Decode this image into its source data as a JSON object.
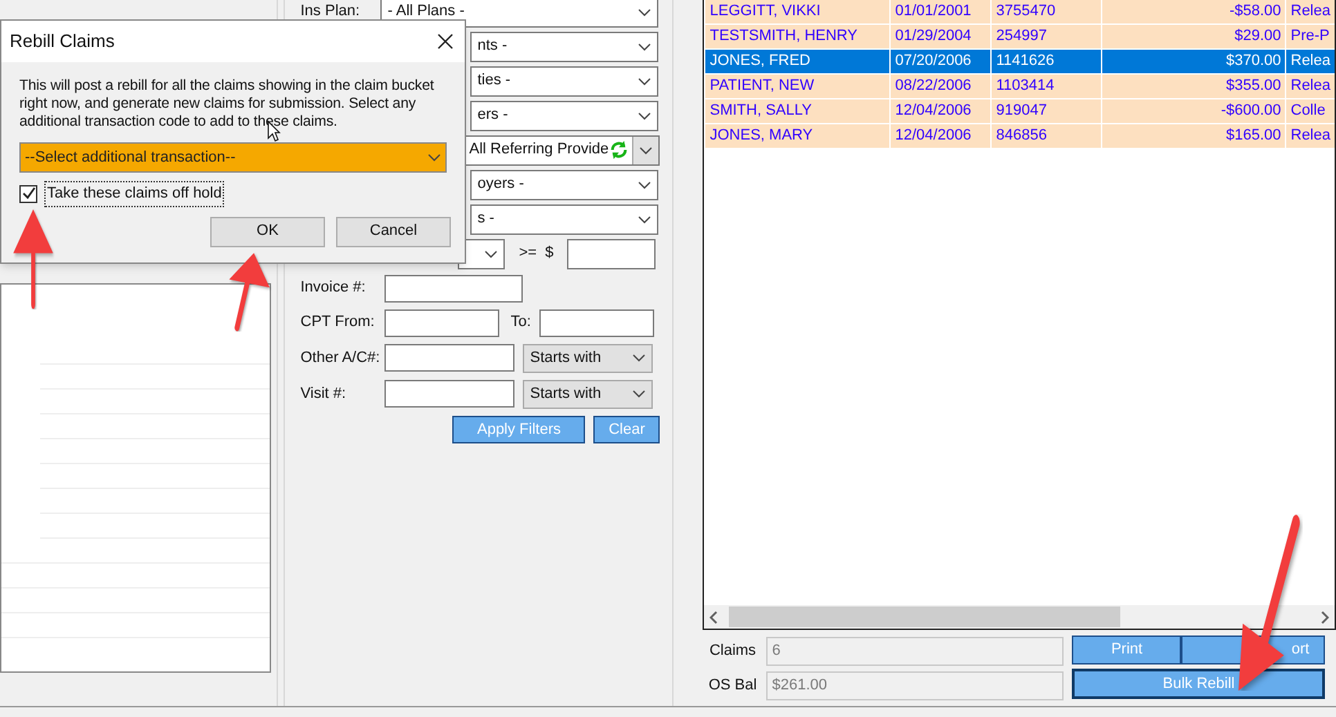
{
  "dialog": {
    "title": "Rebill Claims",
    "message": "This will post a rebill for all the claims showing in the claim bucket right now, and generate new claims for submission. Select any additional transaction code to add to these claims.",
    "transaction_select": {
      "value": "--Select additional transaction--"
    },
    "off_hold_checkbox": {
      "label": "Take these claims off hold",
      "checked": true
    },
    "buttons": [
      "OK",
      "Cancel"
    ]
  },
  "filters": [
    {
      "kind": "select",
      "label": "Ins Plan:",
      "value": "- All Plans -"
    },
    {
      "kind": "select",
      "value": "nts -"
    },
    {
      "kind": "select",
      "value": "ties -"
    },
    {
      "kind": "select",
      "value": "ers -"
    },
    {
      "kind": "refresh_select",
      "value": "All Referring Provide"
    },
    {
      "kind": "select",
      "value": "oyers -"
    },
    {
      "kind": "select",
      "value": "s -"
    },
    {
      "kind": "amount",
      "operator": ">=",
      "currency": "$"
    },
    {
      "kind": "text",
      "label": "Invoice #:"
    },
    {
      "kind": "range",
      "label": "CPT From:",
      "to_label": "To:"
    },
    {
      "kind": "match",
      "label": "Other A/C#:",
      "match": "Starts with"
    },
    {
      "kind": "match",
      "label": "Visit #:",
      "match": "Starts with"
    }
  ],
  "filter_buttons": [
    "Apply Filters",
    "Clear"
  ],
  "claims_table": {
    "rows": [
      {
        "name": "LEGGITT, VIKKI",
        "date": "01/01/2001",
        "account": "3755470",
        "amount": "-$58.00",
        "column_5": "Relea",
        "selected": false
      },
      {
        "name": "TESTSMITH, HENRY",
        "date": "01/29/2004",
        "account": "254997",
        "amount": "$29.00",
        "column_5": "Pre-P",
        "selected": false
      },
      {
        "name": "JONES, FRED",
        "date": "07/20/2006",
        "account": "1141626",
        "amount": "$370.00",
        "column_5": "Relea",
        "selected": true
      },
      {
        "name": "PATIENT, NEW",
        "date": "08/22/2006",
        "account": "1103414",
        "amount": "$355.00",
        "column_5": "Relea",
        "selected": false
      },
      {
        "name": "SMITH, SALLY",
        "date": "12/04/2006",
        "account": "919047",
        "amount": "-$600.00",
        "column_5": "Colle",
        "selected": false
      },
      {
        "name": "JONES, MARY",
        "date": "12/04/2006",
        "account": "846856",
        "amount": "$165.00",
        "column_5": "Relea",
        "selected": false
      }
    ]
  },
  "summary": {
    "claims": {
      "label": "Claims",
      "value": "6"
    },
    "os_bal": {
      "label": "OS Bal",
      "value": "$261.00"
    },
    "buttons": [
      "Print",
      "ort",
      "Bulk Rebill"
    ]
  }
}
